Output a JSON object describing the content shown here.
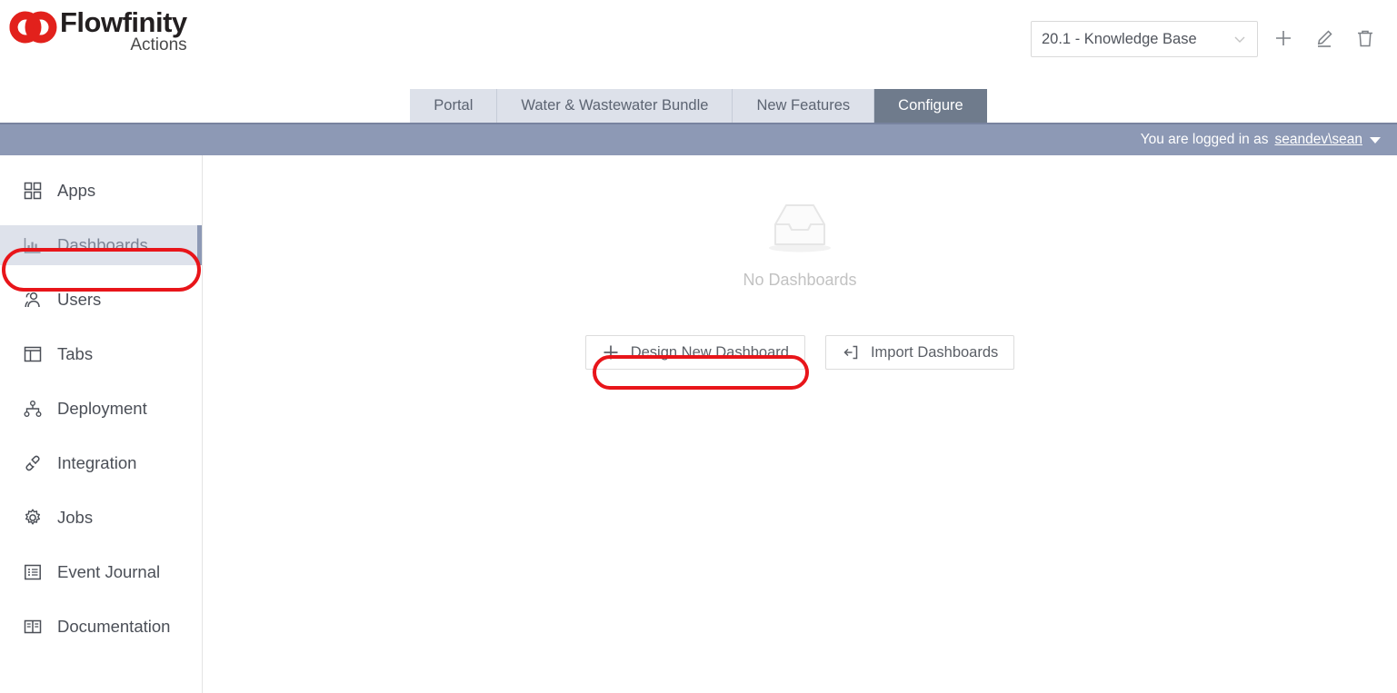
{
  "header": {
    "brand_name": "Flowfinity",
    "brand_sub": "Actions",
    "logo_icon": "flowfinity-rings-logo",
    "app_selector": {
      "value": "20.1 - Knowledge Base",
      "chevron_icon": "chevron-down-icon"
    },
    "actions": [
      {
        "icon": "plus-icon",
        "name": "add-app-button"
      },
      {
        "icon": "pencil-icon",
        "name": "edit-app-button"
      },
      {
        "icon": "trash-icon",
        "name": "delete-app-button"
      }
    ]
  },
  "tabs": [
    {
      "label": "Portal",
      "active": false
    },
    {
      "label": "Water & Wastewater Bundle",
      "active": false
    },
    {
      "label": "New Features",
      "active": false
    },
    {
      "label": "Configure",
      "active": true
    }
  ],
  "userbar": {
    "prefix": "You are logged in as",
    "username": "seandev\\sean",
    "caret_icon": "caret-down-icon"
  },
  "sidebar": {
    "items": [
      {
        "label": "Apps",
        "icon": "apps-grid-icon",
        "active": false
      },
      {
        "label": "Dashboards",
        "icon": "bar-chart-icon",
        "active": true
      },
      {
        "label": "Users",
        "icon": "users-icon",
        "active": false
      },
      {
        "label": "Tabs",
        "icon": "tabs-panel-icon",
        "active": false
      },
      {
        "label": "Deployment",
        "icon": "deployment-nodes-icon",
        "active": false
      },
      {
        "label": "Integration",
        "icon": "plug-connector-icon",
        "active": false
      },
      {
        "label": "Jobs",
        "icon": "gear-icon",
        "active": false
      },
      {
        "label": "Event Journal",
        "icon": "list-journal-icon",
        "active": false
      },
      {
        "label": "Documentation",
        "icon": "open-book-icon",
        "active": false
      }
    ]
  },
  "main": {
    "empty_state": {
      "icon": "empty-tray-icon",
      "text": "No Dashboards"
    },
    "buttons": [
      {
        "label": "Design New Dashboard",
        "icon": "plus-icon",
        "highlighted": true
      },
      {
        "label": "Import Dashboards",
        "icon": "import-icon",
        "highlighted": false
      }
    ]
  },
  "colors": {
    "annotation": "#e8151a",
    "brand_red": "#e2211c",
    "userbar": "#8d99b5",
    "tab_inactive": "#dde1ea",
    "tab_active": "#6f7b8c"
  }
}
